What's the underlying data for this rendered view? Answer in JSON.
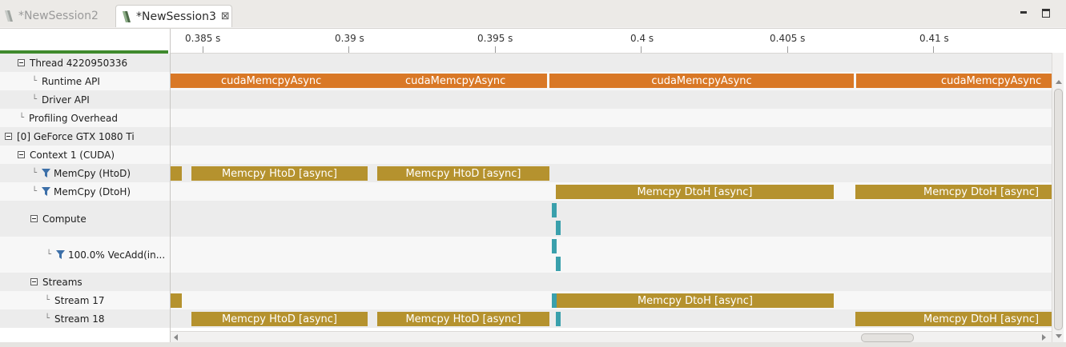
{
  "tabs": [
    {
      "label": "*NewSession2",
      "active": false
    },
    {
      "label": "*NewSession3",
      "active": true
    }
  ],
  "ruler": {
    "ticks": [
      "0.385 s",
      "0.39 s",
      "0.395 s",
      "0.4 s",
      "0.405 s",
      "0.41 s"
    ]
  },
  "tree": {
    "thread": "Thread 4220950336",
    "runtime_api": "Runtime API",
    "driver_api": "Driver API",
    "profiling_overhead": "Profiling Overhead",
    "gpu": "[0] GeForce GTX 1080 Ti",
    "context": "Context 1 (CUDA)",
    "memcpy_htod": "MemCpy (HtoD)",
    "memcpy_dtoh": "MemCpy (DtoH)",
    "compute": "Compute",
    "vecadd": "100.0% VecAdd(in...",
    "streams": "Streams",
    "stream17": "Stream 17",
    "stream18": "Stream 18"
  },
  "bars": {
    "api1": "cudaMemcpyAsync",
    "api2": "cudaMemcpyAsync",
    "api3": "cudaMemcpyAsync",
    "api4": "cudaMemcpyAsync",
    "htod1": "Memcpy HtoD [async]",
    "htod2": "Memcpy HtoD [async]",
    "dtoh1": "Memcpy DtoH [async]",
    "dtoh2": "Memcpy DtoH [async]",
    "s17_dtoh": "Memcpy DtoH [async]",
    "s18_htod1": "Memcpy HtoD [async]",
    "s18_htod2": "Memcpy HtoD [async]",
    "s18_dtoh": "Memcpy DtoH [async]"
  },
  "colors": {
    "api": "#d97826",
    "memcpy": "#b5922e",
    "kernel": "#3aa0ac",
    "progress": "#3f8a2d"
  },
  "icons": {
    "tab_icon": "session-icon",
    "filter": "funnel-icon",
    "expand": "collapse-box-icon",
    "close": "close-icon"
  }
}
